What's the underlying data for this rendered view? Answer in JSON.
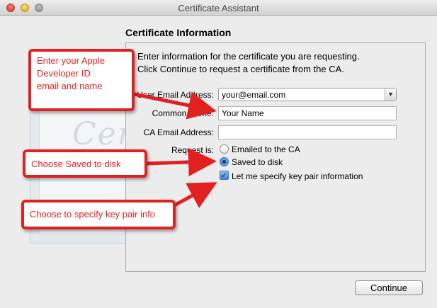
{
  "window": {
    "title": "Certificate Assistant"
  },
  "background": {
    "watermark": "Certificate"
  },
  "section": {
    "title": "Certificate Information"
  },
  "intro": {
    "line1": "Enter information for the certificate you are requesting.",
    "line2": "Click Continue to request a certificate from the CA."
  },
  "form": {
    "user_email_label": "User Email Address:",
    "user_email_value": "your@email.com",
    "common_name_label": "Common Name:",
    "common_name_value": "Your Name",
    "ca_email_label": "CA Email Address:",
    "ca_email_value": "",
    "request_label": "Request is:",
    "request_options": [
      "Emailed to the CA",
      "Saved to disk"
    ],
    "request_selected": "Saved to disk",
    "key_pair_label": "Let me specify key pair information",
    "key_pair_checked": true
  },
  "buttons": {
    "continue": "Continue"
  },
  "callouts": {
    "apple_id": {
      "line1": "Enter your Apple",
      "line2": "Developer ID",
      "line3": "email and name"
    },
    "saved": "Choose Saved to disk",
    "keypair": "Choose to specify key pair info"
  },
  "colors": {
    "callout_red": "#e32020",
    "selection_blue": "#3b82d9"
  }
}
